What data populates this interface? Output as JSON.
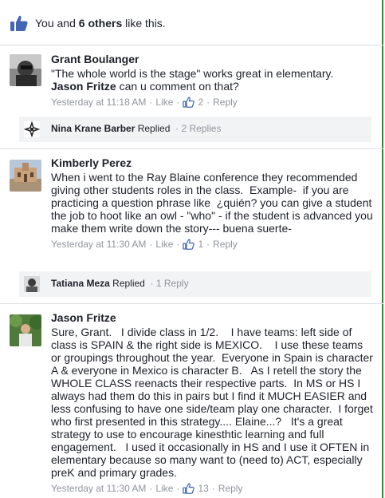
{
  "likes": {
    "prefix": "You and ",
    "others": "6 others",
    "suffix": " like this."
  },
  "comments": [
    {
      "author": "Grant Boulanger",
      "text": "\"The whole world is the stage\" works great in elementary.",
      "mention": "Jason Fritze",
      "text2": " can u comment on that?",
      "time": "Yesterday at 11:18 AM",
      "like": "Like",
      "like_count": "2",
      "reply": "Reply",
      "replied_by": "Nina Krane Barber",
      "replied_word": " Replied",
      "reply_count": "2 Replies"
    },
    {
      "author": "Kimberly Perez",
      "text": "When i went to the Ray Blaine conference they recommended giving other students roles in the class.  Example-  if you are practicing a question phrase like  ¿quién? you can give a student the job to hoot like an owl - \"who\" - if the student is advanced you make them write down the story--- buena suerte-",
      "time": "Yesterday at 11:30 AM",
      "like": "Like",
      "like_count": "1",
      "reply": "Reply",
      "replied_by": "Tatiana Meza",
      "replied_word": " Replied",
      "reply_count": "1 Reply"
    },
    {
      "author": "Jason Fritze",
      "text": "Sure, Grant.   I divide class in 1/2.    I have teams: left side of class is SPAIN & the right side is MEXICO.    I use these teams or groupings throughout the year.  Everyone in Spain is character A & everyone in Mexico is character B.   As I retell the story the WHOLE CLASS reenacts their respective parts.  In MS or HS I always had them do this in pairs but I find it MUCH EASIER and less confusing to have one side/team play one character.  I forget who first presented in this strategy.... Elaine...?   It's a great strategy to use to encourage kinesthtic learning and full engagement.   I used it occasionally in HS and I use it OFTEN in elementary because so many want to (need to) ACT, especially preK and primary grades.",
      "time": "Yesterday at 11:30 AM",
      "like": "Like",
      "like_count": "13",
      "reply": "Reply"
    }
  ],
  "colors": {
    "accent": "#4267b2",
    "muted": "#90949c",
    "reply_bg": "#f2f3f5",
    "divider": "#dddfe2"
  }
}
